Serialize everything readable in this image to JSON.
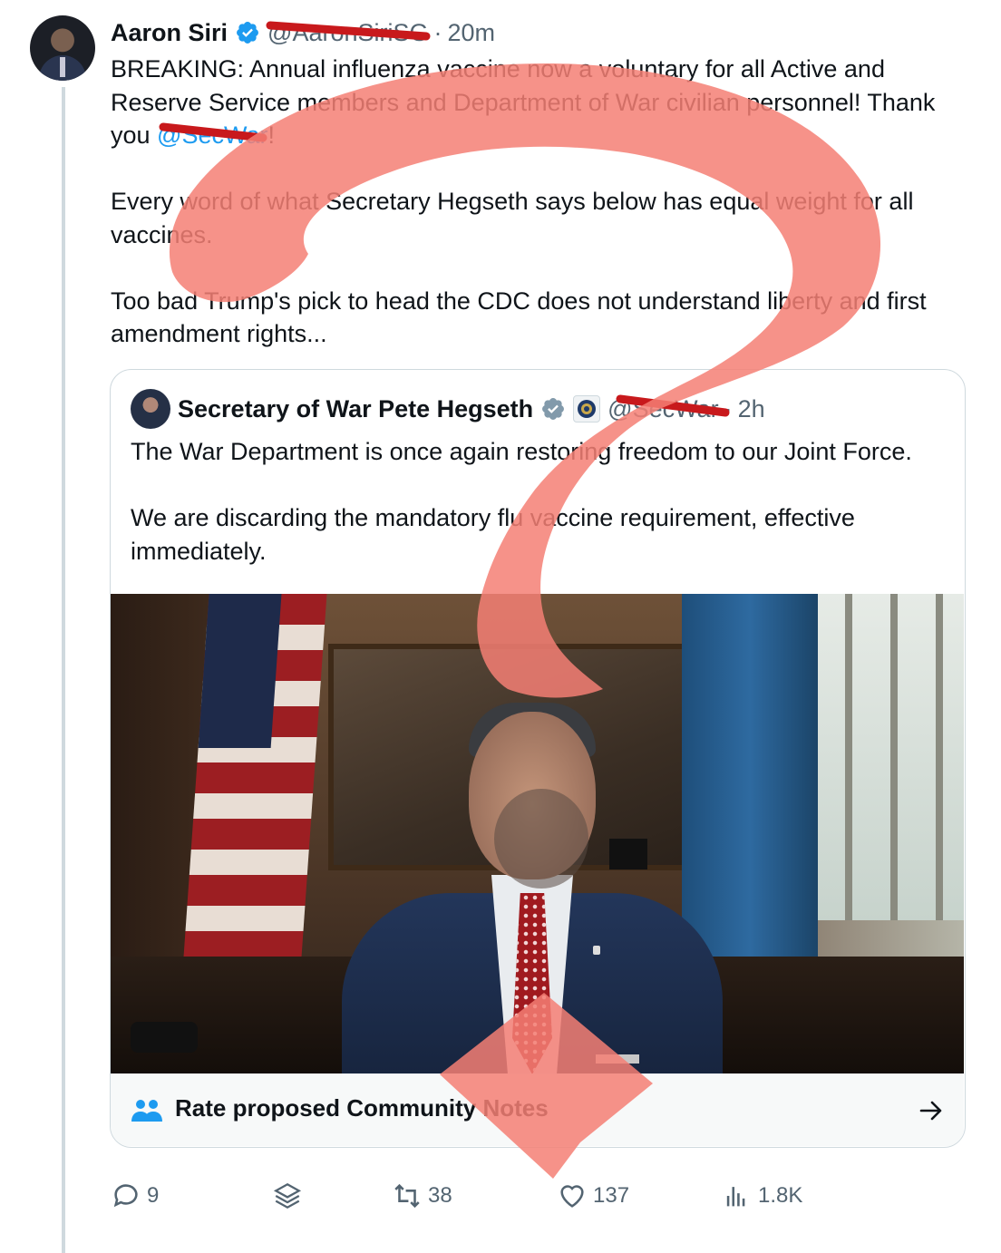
{
  "tweet": {
    "author_name": "Aaron Siri",
    "handle": "@AaronSiriSG",
    "separator": "·",
    "time": "20m",
    "text_part1": "BREAKING: Annual influenza vaccine now a voluntary for all Active and\nReserve Service members and Department of War civilian personnel! Thank\nyou ",
    "mention": "@SecWar",
    "text_part2": "!\n\nEvery word of what Secretary Hegseth says below has equal weight for all\nvaccines.\n\nToo bad Trump's pick to head the CDC does not understand liberty and first\namendment rights..."
  },
  "quote": {
    "author_name": "Secretary of War Pete Hegseth",
    "handle": "@SecWar",
    "separator": "·",
    "time": "2h",
    "text": "The War Department is once again restoring freedom to our Joint Force.\n\nWe are discarding the mandatory flu vaccine requirement, effective\nimmediately.",
    "community_notes_label": "Rate proposed Community Notes"
  },
  "actions": {
    "replies": "9",
    "retweets": "38",
    "likes": "137",
    "views": "1.8K"
  },
  "colors": {
    "accent": "#1d9bf0",
    "muted": "#536471",
    "redaction": "#c8191c",
    "overlay_question_mark": "#f47f74"
  },
  "icons": [
    "verified-badge-icon",
    "people-icon",
    "arrow-right-icon",
    "reply-icon",
    "grok-icon",
    "retweet-icon",
    "like-icon",
    "views-icon",
    "department-seal-icon"
  ]
}
